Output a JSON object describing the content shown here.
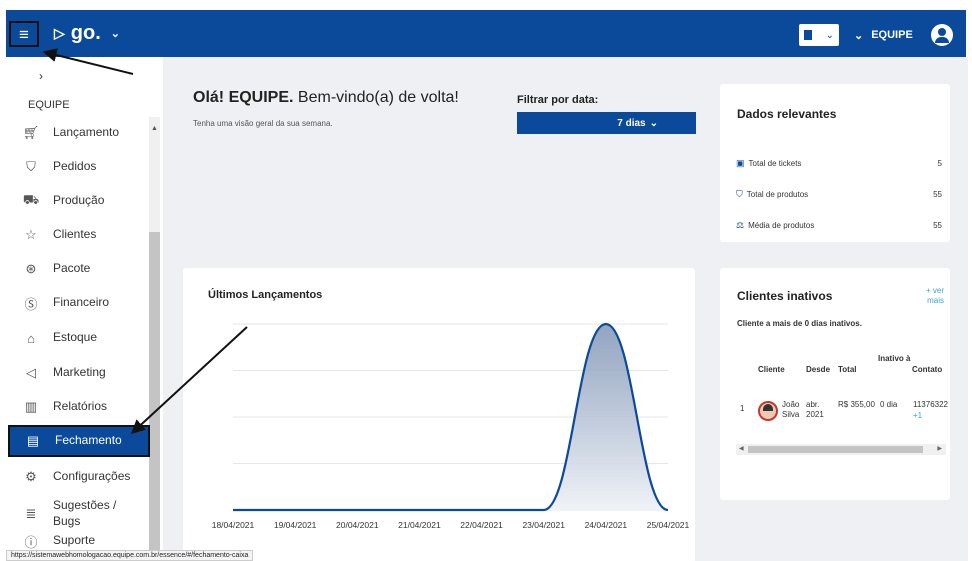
{
  "topbar": {
    "logo_text": "go.",
    "user_label": "EQUIPE"
  },
  "sidebar": {
    "user_label": "EQUIPE",
    "items": [
      {
        "label": "Lançamento",
        "icon": "cart-icon"
      },
      {
        "label": "Pedidos",
        "icon": "shirt-icon"
      },
      {
        "label": "Produção",
        "icon": "truck-icon"
      },
      {
        "label": "Clientes",
        "icon": "star-icon"
      },
      {
        "label": "Pacote",
        "icon": "package-icon"
      },
      {
        "label": "Financeiro",
        "icon": "dollar-icon"
      },
      {
        "label": "Estoque",
        "icon": "box-icon"
      },
      {
        "label": "Marketing",
        "icon": "megaphone-icon"
      },
      {
        "label": "Relatórios",
        "icon": "bar-chart-icon"
      },
      {
        "label": "Fechamento",
        "icon": "register-icon",
        "active": true
      },
      {
        "label": "Configurações",
        "icon": "gear-icon"
      },
      {
        "label": "Sugestões / Bugs",
        "icon": "list-icon"
      },
      {
        "label": "Suporte",
        "icon": "help-icon"
      }
    ]
  },
  "main": {
    "greeting_bold": "Olá! EQUIPE.",
    "greeting_rest": " Bem-vindo(a) de volta!",
    "greeting_sub": "Tenha uma visão geral da sua semana.",
    "filter_label": "Filtrar por data:",
    "filter_value": "7 dias"
  },
  "dados": {
    "title": "Dados relevantes",
    "rows": [
      {
        "label": "Total de tickets",
        "value": "5"
      },
      {
        "label": "Total de produtos",
        "value": "55"
      },
      {
        "label": "Média de produtos",
        "value": "55"
      }
    ]
  },
  "ultimos": {
    "title": "Últimos Lançamentos"
  },
  "chart_data": {
    "type": "area",
    "title": "Últimos Lançamentos",
    "categories": [
      "18/04/2021",
      "19/04/2021",
      "20/04/2021",
      "21/04/2021",
      "22/04/2021",
      "23/04/2021",
      "24/04/2021",
      "25/04/2021"
    ],
    "values": [
      0,
      0,
      0,
      0,
      0,
      0,
      5,
      0
    ],
    "ylim": [
      0,
      5
    ],
    "grid": true,
    "color": "#0b4a9a"
  },
  "clientes": {
    "title": "Clientes inativos",
    "ver_mais": "+ ver mais",
    "subtitle": "Cliente a mais de 0 dias inativos.",
    "headers": {
      "cliente": "Cliente",
      "desde": "Desde",
      "total": "Total",
      "inativo": "Inativo à",
      "contato": "Contato"
    },
    "row": {
      "index": "1",
      "nome": "João Silva",
      "desde": "abr. 2021",
      "total": "R$ 355,00",
      "inativo": "0 dia",
      "contato": "11376322",
      "contato_extra": "+1"
    }
  },
  "status_url": "https://sistemawebhomologacao.equipe.com.br/essence/#/fechamento-caixa"
}
